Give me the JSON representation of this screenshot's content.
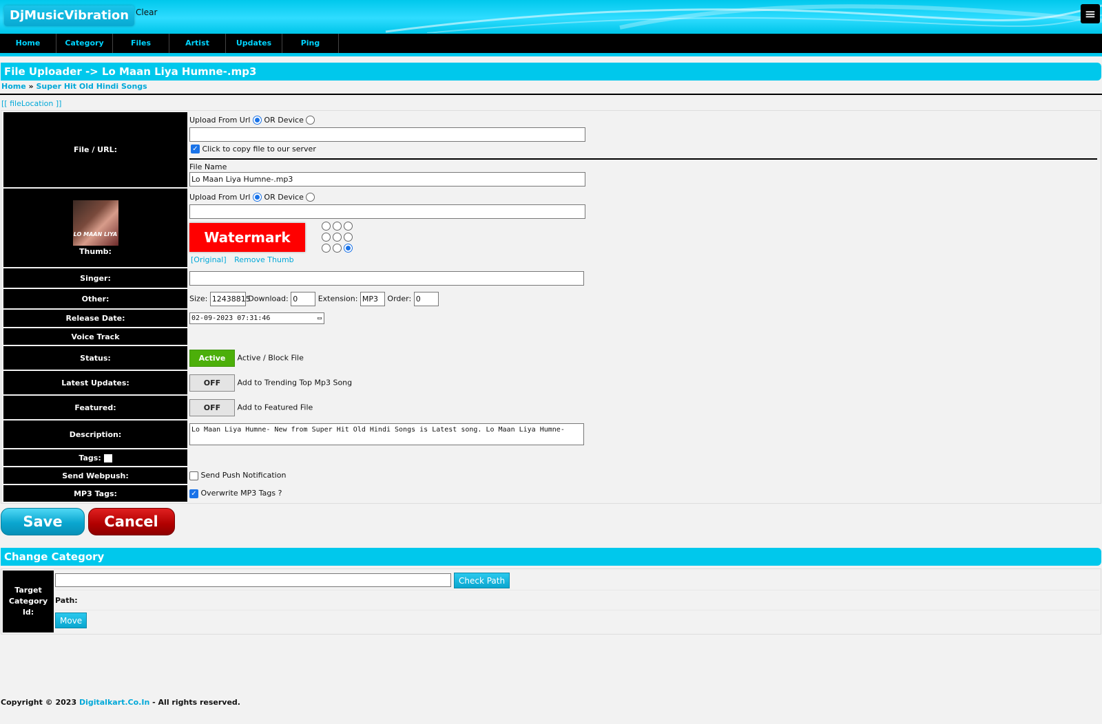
{
  "header": {
    "logo": "DjMusicVibration",
    "clear_label": "Clear",
    "menu_icon": "≡"
  },
  "nav": {
    "items": [
      "Home",
      "Category",
      "Files",
      "Artist",
      "Updates",
      "Ping"
    ]
  },
  "page_title": "File Uploader -> Lo Maan Liya Humne-.mp3",
  "breadcrumb": {
    "home": "Home",
    "sep": "»",
    "category": "Super Hit Old Hindi Songs"
  },
  "file_location": "[[ fileLocation ]]",
  "form": {
    "file": {
      "label": "File / URL:",
      "upload_from_url": "Upload From Url",
      "or_device": "OR Device",
      "url_value": "",
      "copy_label": "Click to copy file to our server",
      "copy_checked": true,
      "file_name_label": "File Name",
      "file_name_value": "Lo Maan Liya Humne-.mp3"
    },
    "thumb": {
      "label": "Thumb:",
      "image_caption": "LO MAAN LIYA",
      "upload_from_url": "Upload From Url",
      "or_device": "OR Device",
      "url_value": "",
      "watermark_label": "Watermark",
      "original_link": "[Original]",
      "remove_link": "Remove Thumb",
      "watermark_position": "bottom-right"
    },
    "singer": {
      "label": "Singer:",
      "value": ""
    },
    "other": {
      "label": "Other:",
      "size_label": "Size:",
      "size_value": "12438815",
      "download_label": "Download:",
      "download_value": "0",
      "extension_label": "Extension:",
      "extension_value": "MP3",
      "order_label": "Order:",
      "order_value": "0"
    },
    "release_date": {
      "label": "Release Date:",
      "value": "02-09-2023  07:31:46"
    },
    "voice_track": {
      "label": "Voice Track"
    },
    "status": {
      "label": "Status:",
      "toggle": "Active",
      "desc": "Active / Block File"
    },
    "latest_updates": {
      "label": "Latest Updates:",
      "toggle": "OFF",
      "desc": "Add to Trending Top Mp3 Song"
    },
    "featured": {
      "label": "Featured:",
      "toggle": "OFF",
      "desc": "Add to Featured File"
    },
    "description": {
      "label": "Description:",
      "value": "Lo Maan Liya Humne- New  from Super Hit Old Hindi Songs is Latest song. Lo Maan Liya Humne-"
    },
    "tags": {
      "label": "Tags:"
    },
    "webpush": {
      "label": "Send Webpush:",
      "check_label": "Send Push Notification",
      "checked": false
    },
    "mp3_tags": {
      "label": "MP3 Tags:",
      "check_label": "Overwrite MP3 Tags ?",
      "checked": true
    }
  },
  "actions": {
    "save": "Save",
    "cancel": "Cancel"
  },
  "change_category": {
    "title": "Change Category",
    "label": "Target Category Id:",
    "input_value": "",
    "check_path": "Check Path",
    "path_label": "Path:",
    "move": "Move"
  },
  "footer": {
    "copyright": "Copyright © 2023",
    "site": "Digitalkart.Co.In",
    "rights": "- All rights reserved."
  },
  "colors": {
    "accent": "#00c8ec",
    "nav_bg": "#000000",
    "nav_text": "#00d4ff",
    "active": "#4caf0a",
    "cancel": "#b00000",
    "watermark": "#ff0000"
  }
}
